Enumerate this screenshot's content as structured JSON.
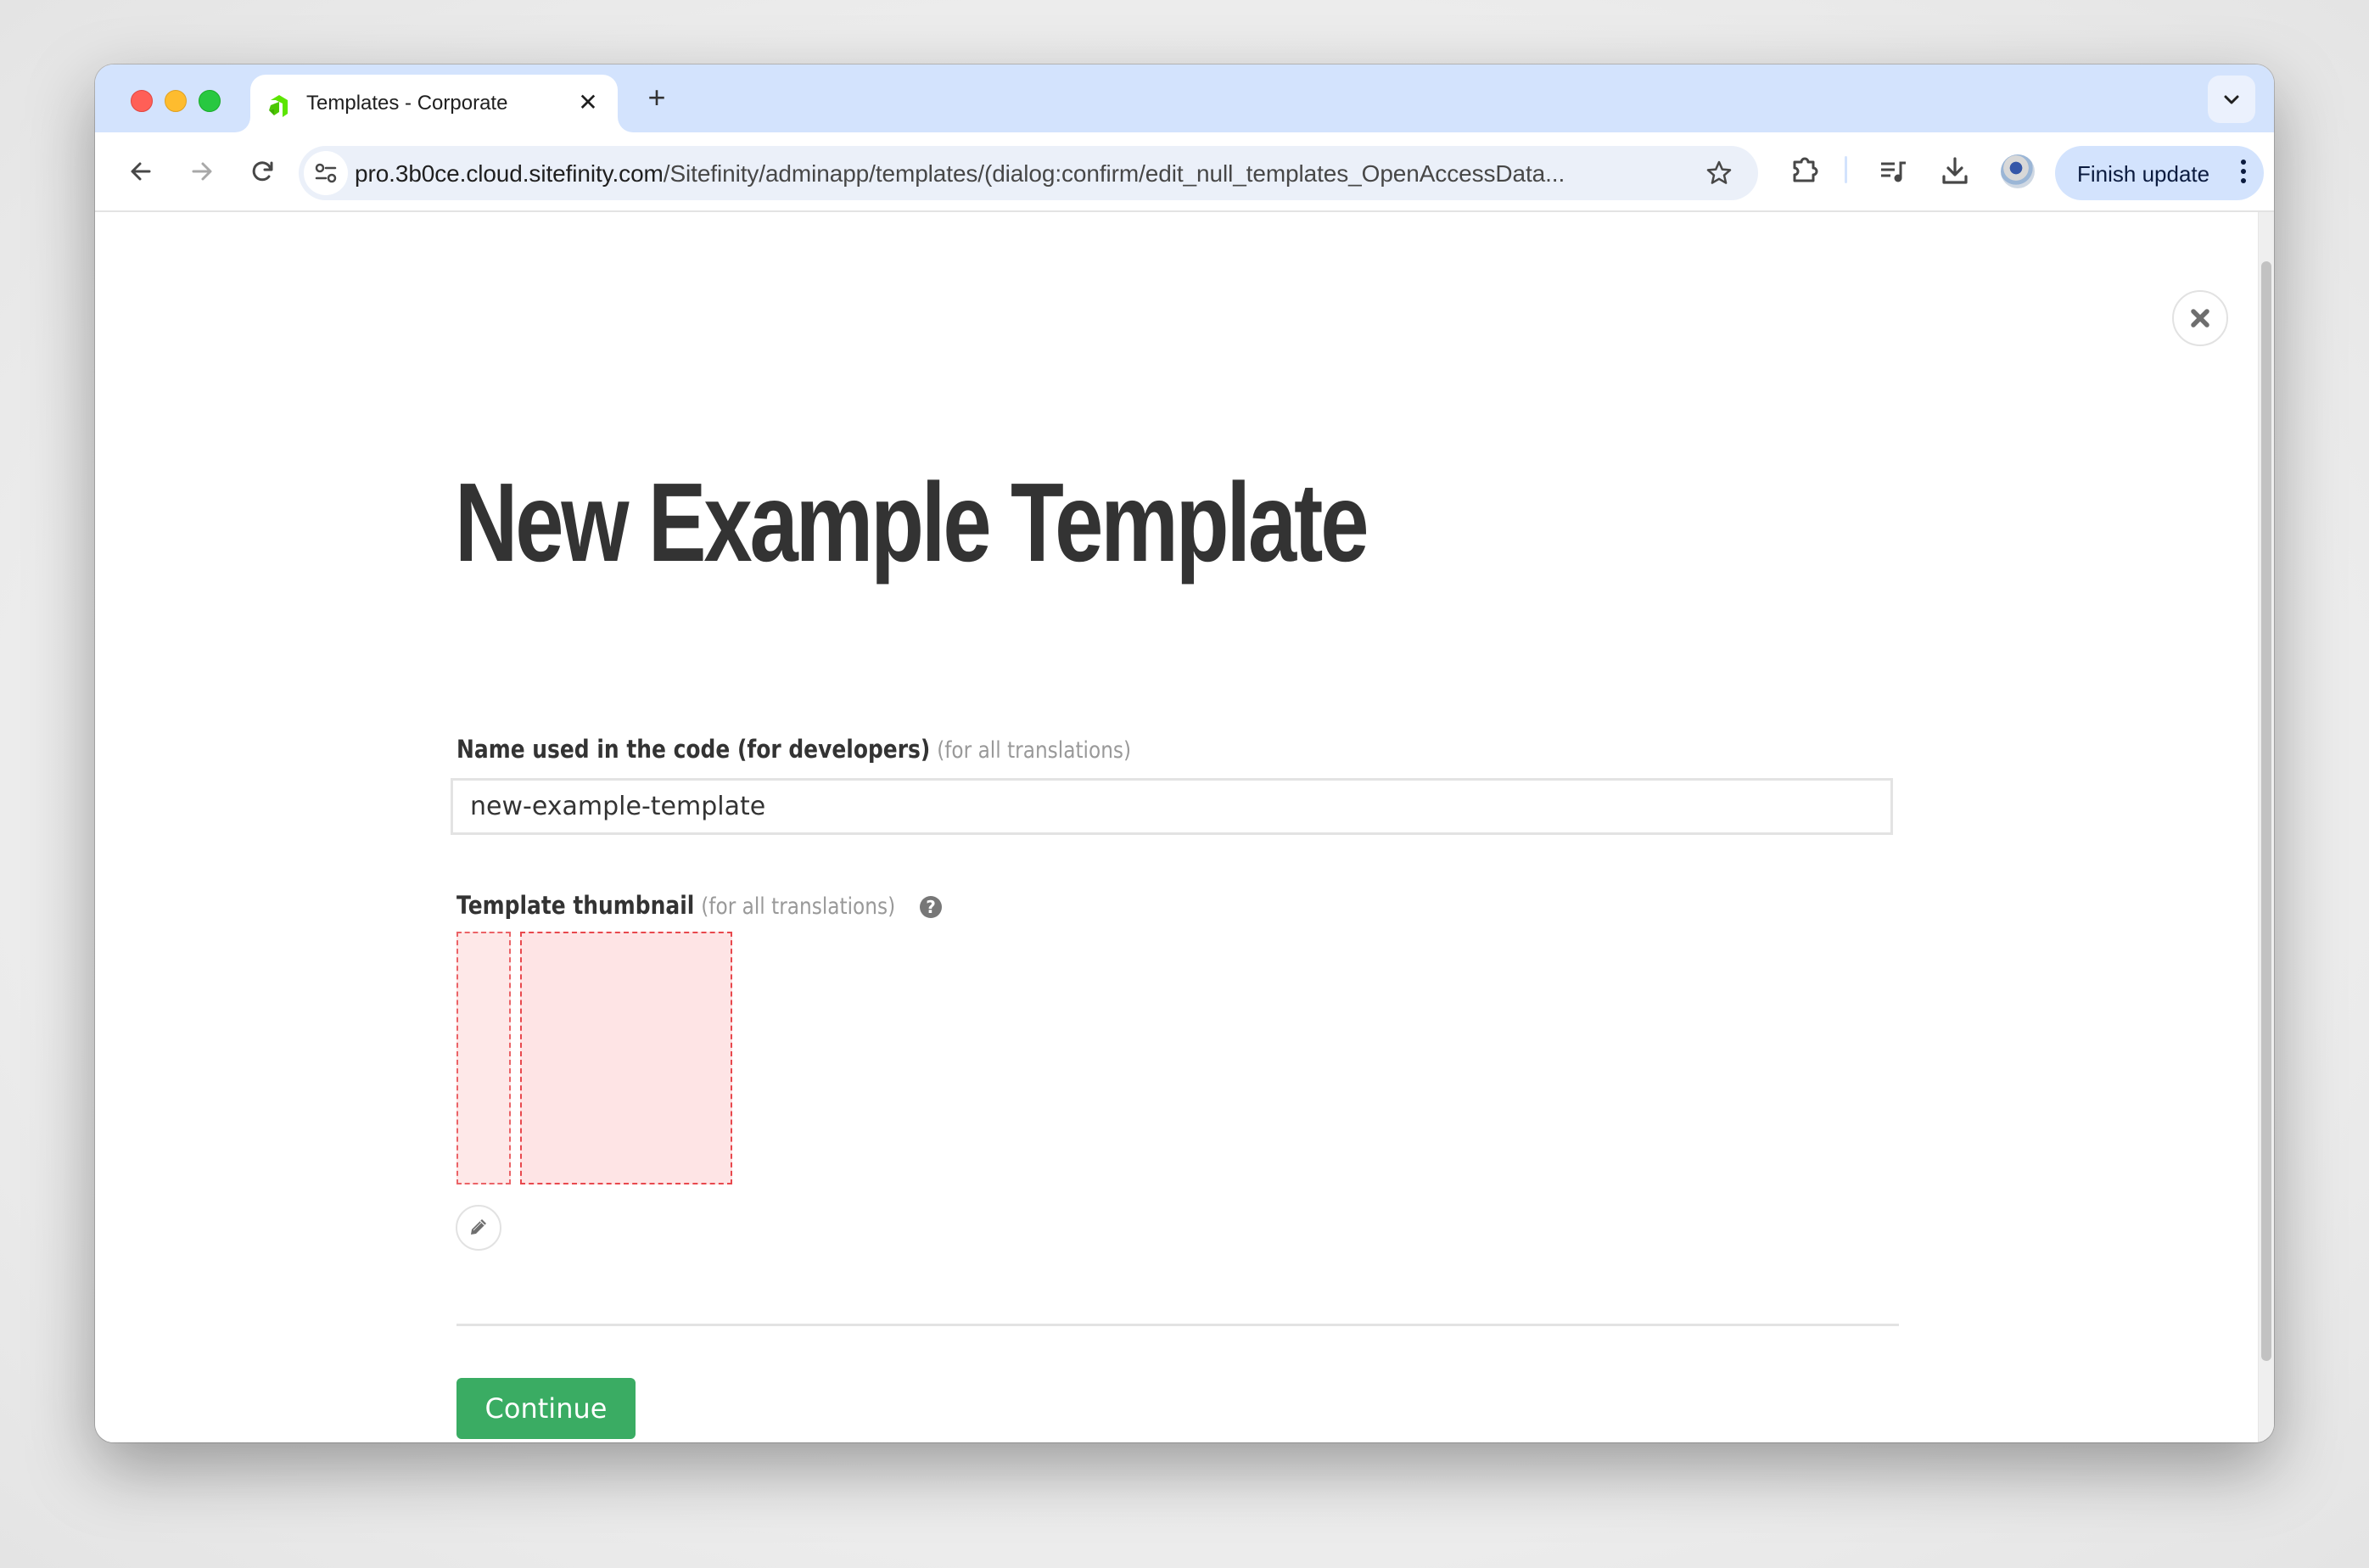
{
  "browser": {
    "tab": {
      "title": "Templates - Corporate",
      "favicon": "sitefinity-logo-icon",
      "close_glyph": "✕"
    },
    "new_tab_glyph": "+",
    "url": {
      "host": "pro.3b0ce.cloud.sitefinity.com",
      "path": "/Sitefinity/adminapp/templates/(dialog:confirm/edit_null_templates_OpenAccessData..."
    },
    "toolbar_icons": [
      "back-icon",
      "forward-icon",
      "reload-icon",
      "site-info-icon",
      "bookmark-star-icon",
      "extensions-icon",
      "media-controls-icon",
      "downloads-icon",
      "profile-avatar"
    ],
    "finish_update_label": "Finish update",
    "accent_color": "#d3e3fd"
  },
  "dialog": {
    "close_icon": "close-icon",
    "title": "New Example Template",
    "name_field": {
      "label": "Name used in the code (for developers)",
      "hint": "(for all translations)",
      "value": "new-example-template"
    },
    "thumbnail_field": {
      "label": "Template thumbnail",
      "hint": "(for all translations)",
      "help_glyph": "?"
    },
    "edit_icon": "pencil-icon",
    "continue_label": "Continue",
    "continue_color": "#3aac63"
  }
}
